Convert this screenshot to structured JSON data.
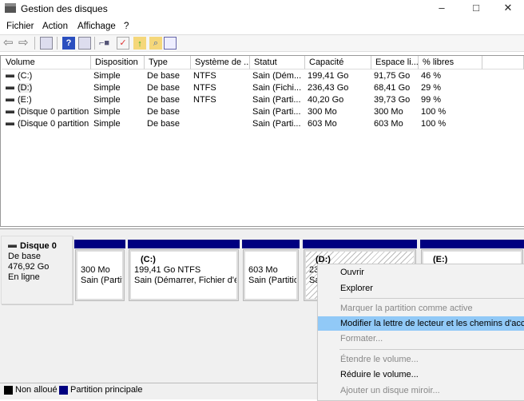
{
  "window": {
    "title": "Gestion des disques",
    "minimize": "–",
    "maximize": "□",
    "close": "✕"
  },
  "menu": [
    "Fichier",
    "Action",
    "Affichage",
    "?"
  ],
  "toolbar": [
    "back-icon",
    "forward-icon",
    "console-tree-icon",
    "help-icon",
    "action-pane-icon",
    "connect-drive-icon",
    "checklist-icon",
    "folder-up-icon",
    "folder-search-icon",
    "properties-icon"
  ],
  "table": {
    "columns": [
      "Volume",
      "Disposition",
      "Type",
      "Système de ...",
      "Statut",
      "Capacité",
      "Espace li...",
      "% libres"
    ],
    "rows": [
      [
        "(C:)",
        "Simple",
        "De base",
        "NTFS",
        "Sain (Dém...",
        "199,41 Go",
        "91,75 Go",
        "46 %"
      ],
      [
        "(D:)",
        "Simple",
        "De base",
        "NTFS",
        "Sain (Fichi...",
        "236,43 Go",
        "68,41 Go",
        "29 %"
      ],
      [
        "(E:)",
        "Simple",
        "De base",
        "NTFS",
        "Sain (Parti...",
        "40,20 Go",
        "39,73 Go",
        "99 %"
      ],
      [
        "(Disque 0 partition...",
        "Simple",
        "De base",
        "",
        "Sain (Parti...",
        "300 Mo",
        "300 Mo",
        "100 %"
      ],
      [
        "(Disque 0 partition...",
        "Simple",
        "De base",
        "",
        "Sain (Parti...",
        "603 Mo",
        "603 Mo",
        "100 %"
      ]
    ]
  },
  "disk": {
    "name": "Disque 0",
    "type": "De base",
    "size": "476,92 Go",
    "state": "En ligne"
  },
  "partitions": [
    {
      "name": "",
      "l1": "300 Mo",
      "l2": "Sain (Partiti"
    },
    {
      "name": "(C:)",
      "l1": "199,41 Go NTFS",
      "l2": "Sain (Démarrer, Fichier d'éch"
    },
    {
      "name": "",
      "l1": "603 Mo",
      "l2": "Sain (Partition"
    },
    {
      "name": "(D:)",
      "l1": "23",
      "l2": "Sa"
    },
    {
      "name": "(E:)",
      "l1": "",
      "l2": ""
    }
  ],
  "legend": {
    "unallocated": "Non alloué",
    "primary": "Partition principale",
    "colors": {
      "unallocated": "#000000",
      "primary": "#000080"
    }
  },
  "context_menu": [
    {
      "label": "Ouvrir",
      "enabled": true
    },
    {
      "label": "Explorer",
      "enabled": true
    },
    {
      "label": "Marquer la partition comme active",
      "enabled": false
    },
    {
      "label": "Modifier la lettre de lecteur et les chemins d'accès...",
      "enabled": true,
      "highlighted": true
    },
    {
      "label": "Formater...",
      "enabled": false
    },
    {
      "label": "Étendre le volume...",
      "enabled": false
    },
    {
      "label": "Réduire le volume...",
      "enabled": true
    },
    {
      "label": "Ajouter un disque miroir...",
      "enabled": false
    }
  ]
}
